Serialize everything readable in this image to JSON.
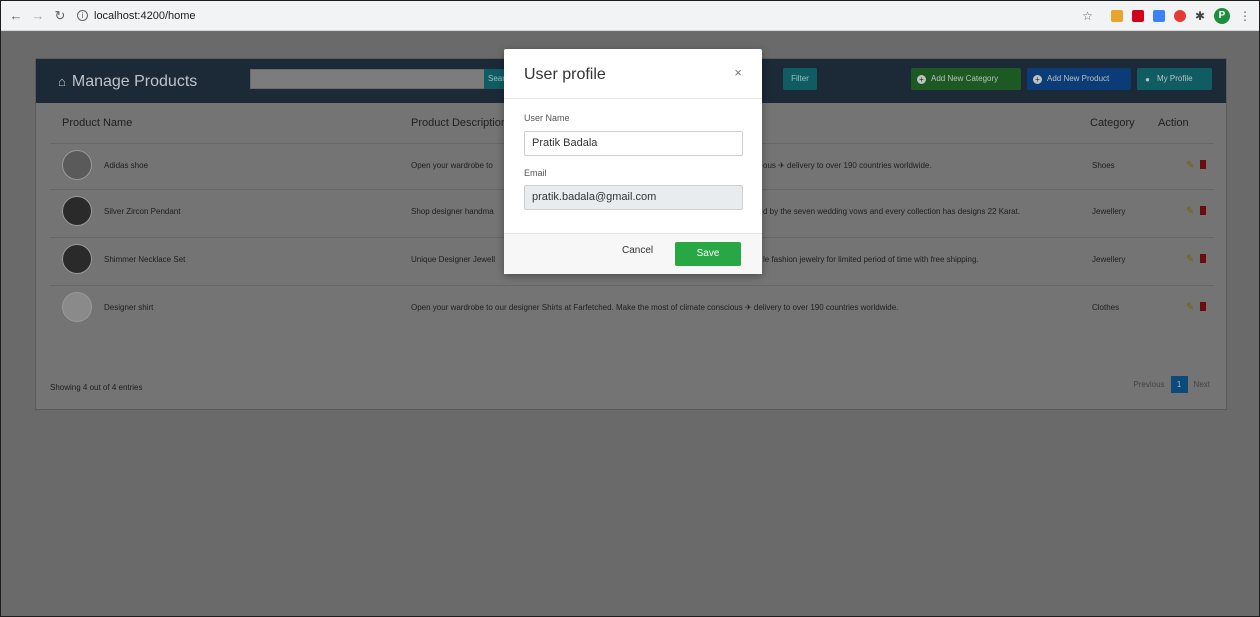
{
  "browser": {
    "url": "localhost:4200/home",
    "profile_initial": "P"
  },
  "header": {
    "title": "Manage Products",
    "search_button": "Search",
    "filter_button": "Filter",
    "add_category_button": "Add New Category",
    "add_product_button": "Add New Product",
    "my_profile_button": "My Profile"
  },
  "table": {
    "columns": [
      "Product Name",
      "Product Description",
      "Category",
      "Action"
    ],
    "rows": [
      {
        "name": "Adidas shoe",
        "description_left": "Open your wardrobe to",
        "description_right": "ous ✈ delivery to over 190 countries worldwide.",
        "category": "Shoes"
      },
      {
        "name": "Silver Zircon Pendant",
        "description_left": "Shop designer handma",
        "description_right": "d by the seven wedding vows and every collection has designs 22 Karat.",
        "category": "Jewellery"
      },
      {
        "name": "Shimmer Necklace Set",
        "description_left": "Unique Designer Jewell",
        "description_right": "le fashion jewelry for limited period of time with free shipping.",
        "category": "Jewellery"
      },
      {
        "name": "Designer shirt",
        "description": "Open your wardrobe to our designer Shirts at Farfetched. Make the most of climate conscious ✈ delivery to over 190 countries worldwide.",
        "category": "Clothes"
      }
    ],
    "footer": "Showing 4 out of 4 entries",
    "pagination": {
      "previous": "Previous",
      "current": "1",
      "next": "Next"
    }
  },
  "modal": {
    "title": "User profile",
    "close": "×",
    "username_label": "User Name",
    "username_value": "Pratik Badala",
    "email_label": "Email",
    "email_value": "pratik.badala@gmail.com",
    "cancel_button": "Cancel",
    "save_button": "Save"
  },
  "colors": {
    "save": "#28a745",
    "header": "#1c2937"
  }
}
